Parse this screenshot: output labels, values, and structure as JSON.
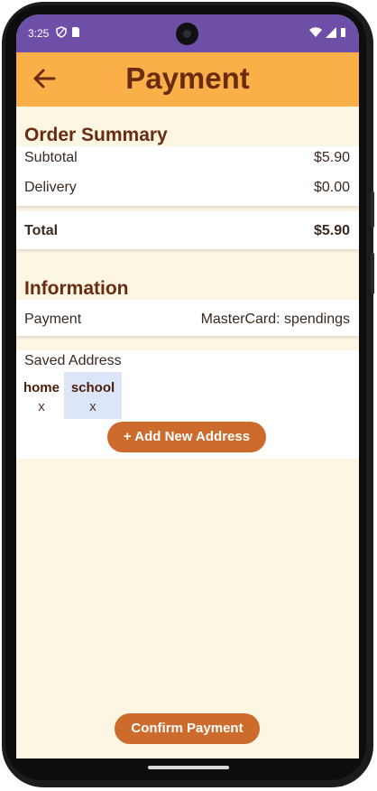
{
  "status_bar": {
    "time": "3:25",
    "icons_left": [
      "shield-icon",
      "sim-icon"
    ],
    "icons_right": [
      "wifi-icon",
      "signal-icon",
      "battery-icon"
    ],
    "color": "#6e4fa8"
  },
  "app_bar": {
    "title": "Payment",
    "back_icon": "arrow-left-icon",
    "color": "#fbaf48"
  },
  "order_summary": {
    "title": "Order Summary",
    "subtotal_label": "Subtotal",
    "subtotal_value": "$5.90",
    "delivery_label": "Delivery",
    "delivery_value": "$0.00",
    "total_label": "Total",
    "total_value": "$5.90"
  },
  "information": {
    "title": "Information",
    "payment_label": "Payment",
    "payment_value": "MasterCard: spendings",
    "saved_address_label": "Saved Address",
    "addresses": [
      {
        "name": "home",
        "remove": "x",
        "selected": false
      },
      {
        "name": "school",
        "remove": "x",
        "selected": true
      }
    ],
    "add_address_label": "+ Add New Address"
  },
  "confirm_label": "Confirm Payment",
  "colors": {
    "background": "#fcf6e3",
    "accent_button": "#cc6b2c",
    "heading": "#6b2b10",
    "selected_chip": "#dde6f8"
  }
}
